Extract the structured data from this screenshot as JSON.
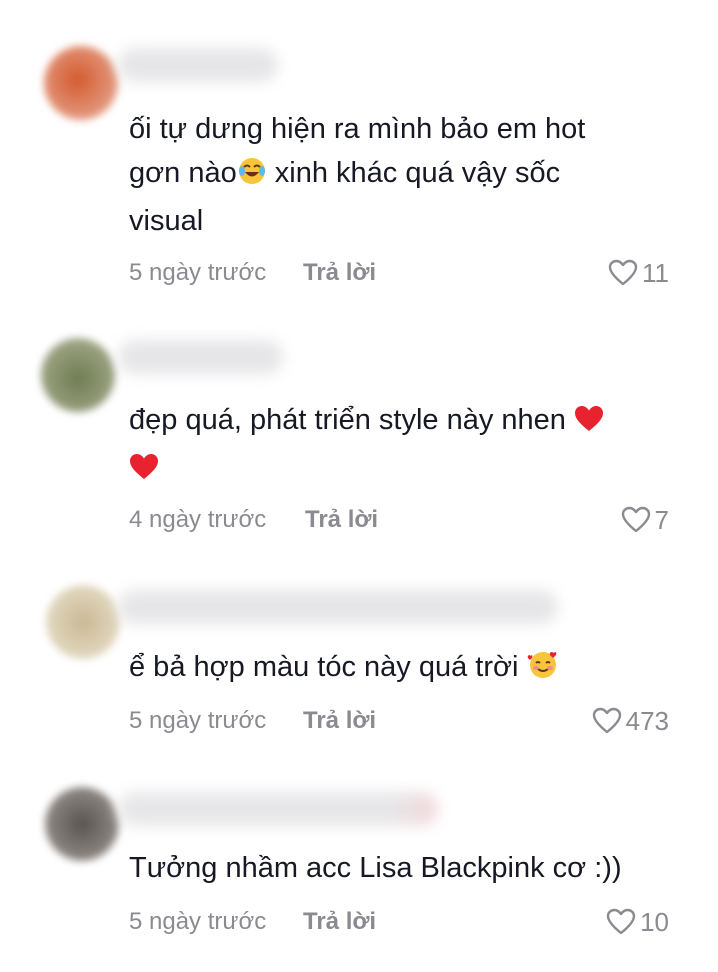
{
  "comments": [
    {
      "text_lines": [
        "ối tự dưng hiện ra mình bảo em hot",
        "gơn nào",
        " xinh khác quá vậy sốc",
        "visual"
      ],
      "emoji": "face-with-tears-of-joy",
      "date": "5 ngày trước",
      "reply": "Trả lời",
      "likes": "11"
    },
    {
      "text_line1": "đẹp quá, phát triển style này nhen",
      "emoji": "red-heart",
      "date": "4 ngày trước",
      "reply": "Trả lời",
      "likes": "7"
    },
    {
      "text": "ể bả hợp màu tóc này quá trời",
      "emoji": "smiling-face-with-hearts",
      "date": "5 ngày trước",
      "reply": "Trả lời",
      "likes": "473"
    },
    {
      "text": "Tưởng nhầm acc Lisa Blackpink cơ :))",
      "date": "5 ngày trước",
      "reply": "Trả lời",
      "likes": "10"
    }
  ],
  "colors": {
    "text": "#161823",
    "meta": "#8a8b91",
    "heart_emoji": "#e8232f",
    "avatar_1": "#d0683f",
    "avatar_2": "#7c8762",
    "avatar_3": "#d8ceb0",
    "avatar_4": "#6e6864"
  }
}
